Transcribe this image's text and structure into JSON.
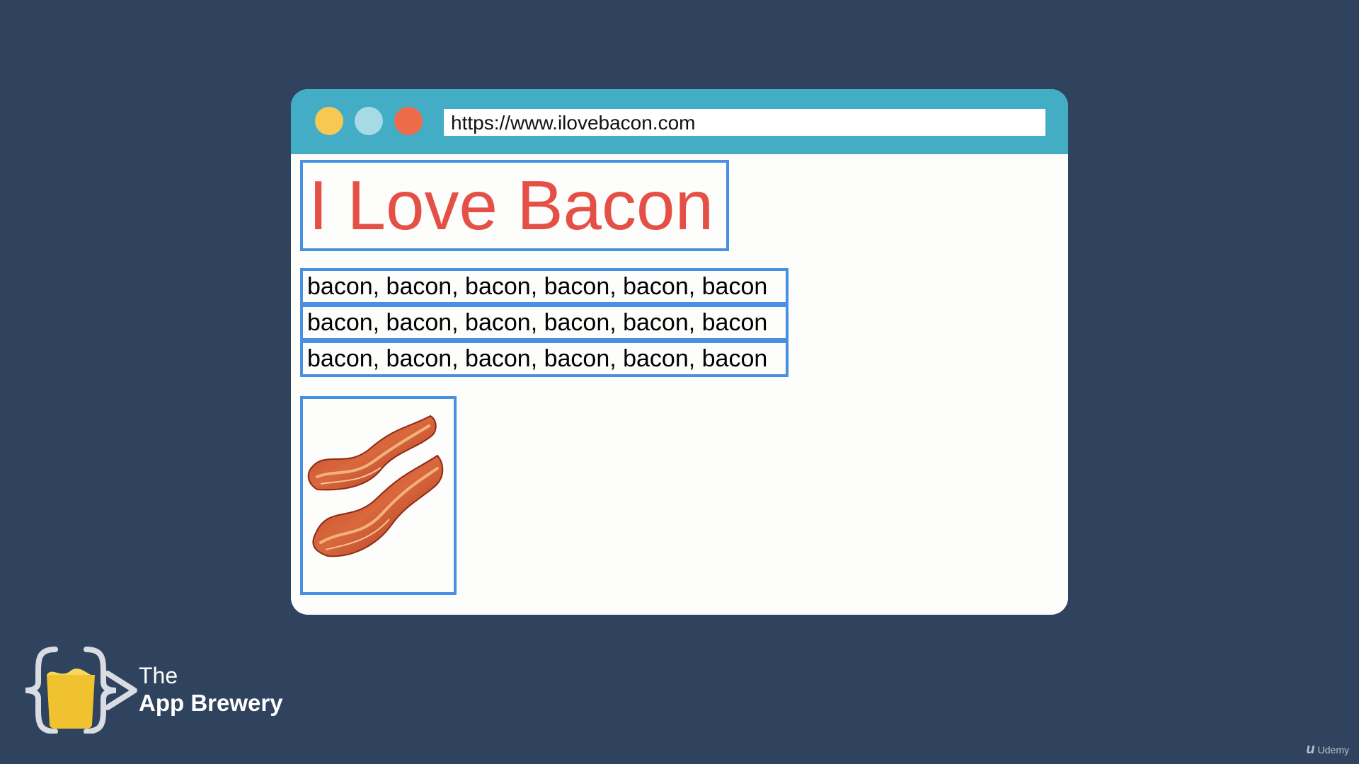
{
  "browser": {
    "url": "https://www.ilovebacon.com",
    "window_controls": [
      "yellow",
      "light-blue",
      "red"
    ]
  },
  "page": {
    "heading": "I Love Bacon",
    "paragraphs": [
      "bacon, bacon, bacon, bacon, bacon, bacon",
      "bacon, bacon, bacon, bacon, bacon, bacon",
      "bacon, bacon, bacon, bacon, bacon, bacon"
    ],
    "image": {
      "icon": "bacon-emoji"
    }
  },
  "branding": {
    "logo_line1": "The",
    "logo_line2": "App Brewery",
    "watermark": "Udemy"
  },
  "colors": {
    "background": "#30435e",
    "titlebar": "#42adc4",
    "heading": "#e55046",
    "box_outline": "#4a90e2",
    "logo_cup": "#f1c22f"
  }
}
